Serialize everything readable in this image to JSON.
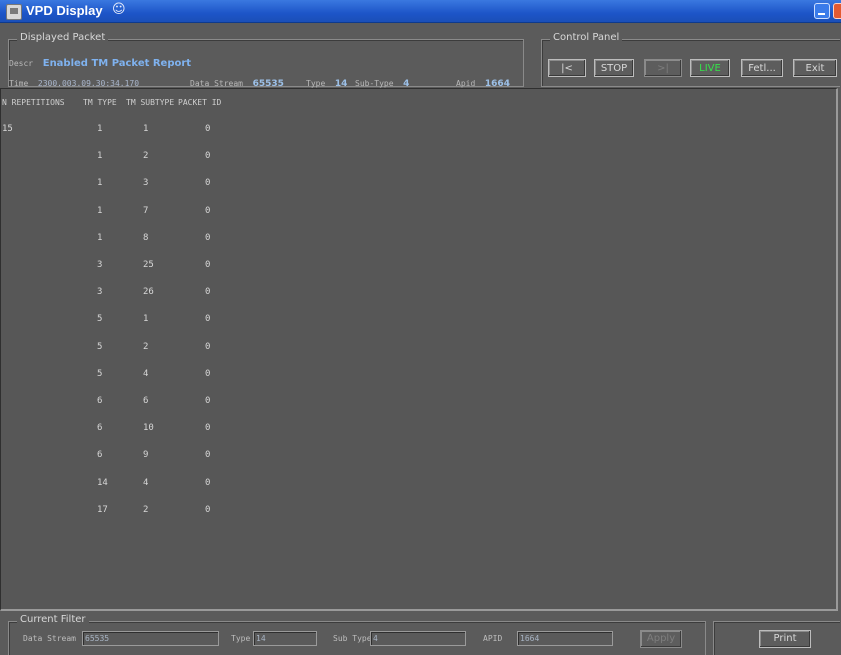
{
  "window": {
    "title": "VPD Display",
    "title_glyph": "☺"
  },
  "displayed_packet": {
    "group_label": "Displayed Packet",
    "descr_label": "Descr",
    "descr_value": "Enabled TM Packet Report",
    "time_label": "Time",
    "time_value": "2300.003.09.30:34.170",
    "data_stream_label": "Data Stream",
    "data_stream_value": "65535",
    "type_label": "Type",
    "type_value": "14",
    "subtype_label": "Sub-Type",
    "subtype_value": "4",
    "apid_label": "Apid",
    "apid_value": "1664"
  },
  "control_panel": {
    "group_label": "Control Panel",
    "first_label": "|<",
    "stop_label": "STOP",
    "next_label": ">|",
    "live_label": "LIVE",
    "fetch_label": "Fetl...",
    "exit_label": "Exit",
    "live_color": "#35e24a"
  },
  "table": {
    "columns": [
      "N REPETITIONS",
      "TM TYPE",
      "TM SUBTYPE",
      "PACKET ID"
    ],
    "rows": [
      [
        "15",
        "1",
        "1",
        "0"
      ],
      [
        "",
        "1",
        "2",
        "0"
      ],
      [
        "",
        "1",
        "3",
        "0"
      ],
      [
        "",
        "1",
        "7",
        "0"
      ],
      [
        "",
        "1",
        "8",
        "0"
      ],
      [
        "",
        "3",
        "25",
        "0"
      ],
      [
        "",
        "3",
        "26",
        "0"
      ],
      [
        "",
        "5",
        "1",
        "0"
      ],
      [
        "",
        "5",
        "2",
        "0"
      ],
      [
        "",
        "5",
        "4",
        "0"
      ],
      [
        "",
        "6",
        "6",
        "0"
      ],
      [
        "",
        "6",
        "10",
        "0"
      ],
      [
        "",
        "6",
        "9",
        "0"
      ],
      [
        "",
        "14",
        "4",
        "0"
      ],
      [
        "",
        "17",
        "2",
        "0"
      ]
    ]
  },
  "current_filter": {
    "group_label": "Current Filter",
    "data_stream_label": "Data Stream",
    "data_stream_value": "65535",
    "type_label": "Type",
    "type_value": "14",
    "subtype_label": "Sub Type",
    "subtype_value": "4",
    "apid_label": "APID",
    "apid_value": "1664",
    "apply_label": "Apply",
    "print_label": "Print"
  }
}
